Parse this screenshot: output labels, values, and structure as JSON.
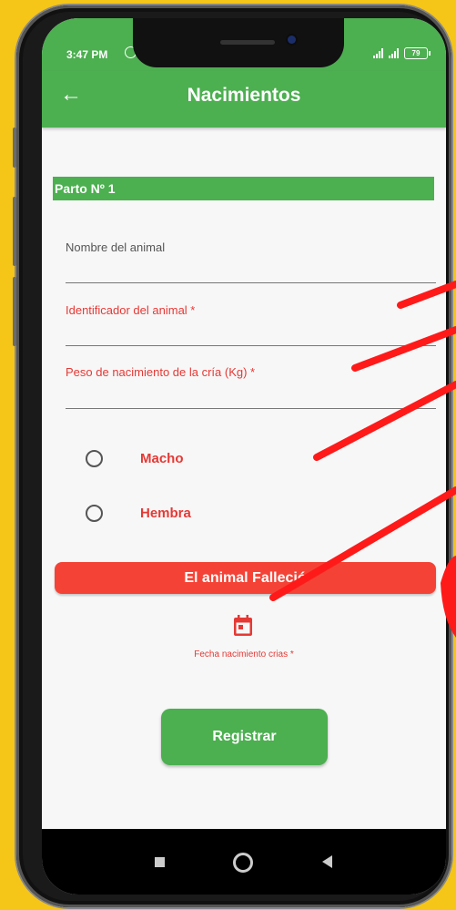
{
  "status": {
    "time": "3:47 PM",
    "battery": "79"
  },
  "appbar": {
    "title": "Nacimientos",
    "back_icon": "arrow-left-icon"
  },
  "form": {
    "section_title": "Parto Nº 1",
    "name_label": "Nombre del animal",
    "id_label": "Identificador del animal *",
    "weight_label": "Peso de nacimiento de la cría (Kg) *",
    "sex_options": [
      "Macho",
      "Hembra"
    ],
    "deceased_button": "El animal Falleció",
    "date_label": "Fecha nacimiento crias *",
    "date_icon": "calendar-icon",
    "submit_button": "Registrar"
  },
  "colors": {
    "accent": "#4caf50",
    "danger": "#f44336",
    "error_text": "#e53935",
    "background": "#f5c518"
  }
}
